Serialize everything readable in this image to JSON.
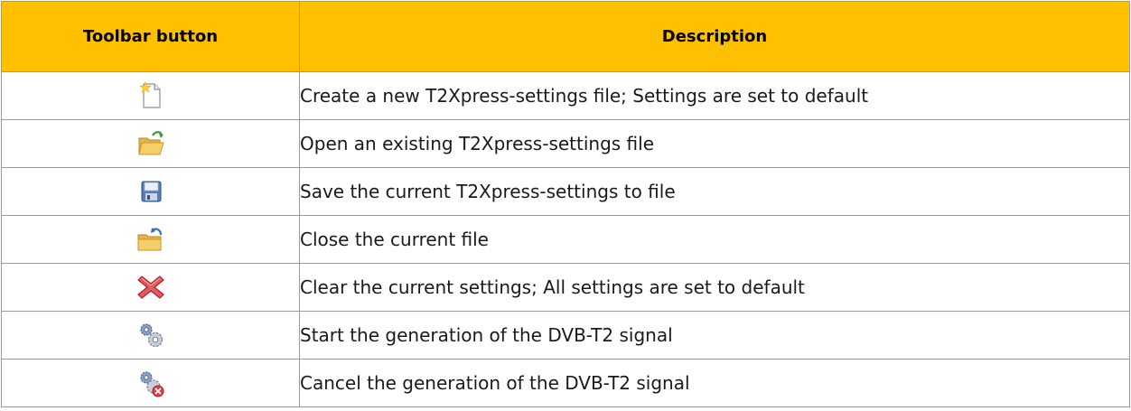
{
  "colors": {
    "header_bg": "#FFC000",
    "border": "#9A9A9A",
    "folder": "#F2C45A",
    "save_blue": "#4A6FA5",
    "clear_red": "#E0424A",
    "gear_blue": "#6F86B0"
  },
  "table": {
    "header": {
      "col_button": "Toolbar button",
      "col_description": "Description"
    },
    "rows": [
      {
        "icon": "new-file-icon",
        "description": "Create a new T2Xpress-settings file; Settings are set to default"
      },
      {
        "icon": "open-folder-icon",
        "description": "Open an existing T2Xpress-settings file"
      },
      {
        "icon": "save-disk-icon",
        "description": "Save the current T2Xpress-settings to file"
      },
      {
        "icon": "close-folder-icon",
        "description": "Close the current file"
      },
      {
        "icon": "clear-x-icon",
        "description": "Clear the current settings; All settings are set to default"
      },
      {
        "icon": "gears-start-icon",
        "description": "Start the generation of the DVB-T2 signal"
      },
      {
        "icon": "gears-cancel-icon",
        "description": "Cancel the generation of the DVB-T2 signal"
      }
    ]
  }
}
